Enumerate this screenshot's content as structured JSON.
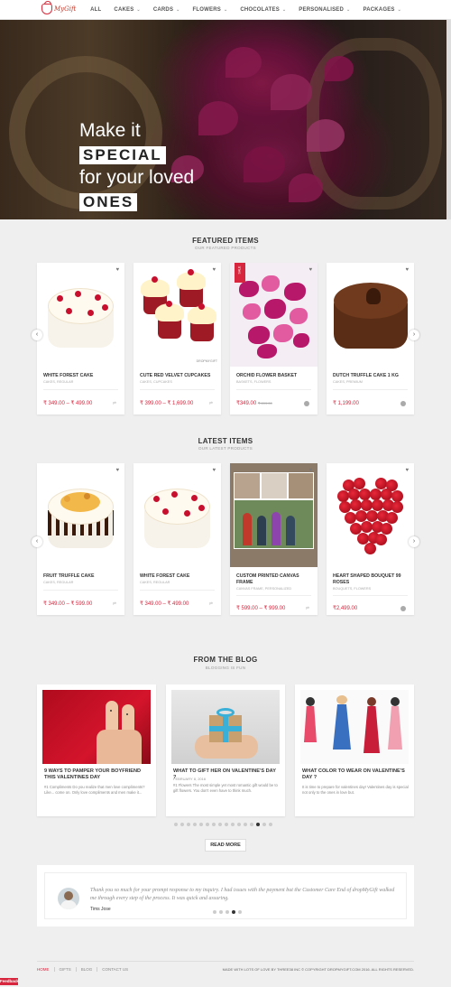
{
  "brand": {
    "logo_text": "MyGift"
  },
  "nav": {
    "items": [
      {
        "label": "ALL",
        "has_dropdown": false
      },
      {
        "label": "CAKES",
        "has_dropdown": true
      },
      {
        "label": "CARDS",
        "has_dropdown": true
      },
      {
        "label": "FLOWERS",
        "has_dropdown": true
      },
      {
        "label": "CHOCOLATES",
        "has_dropdown": true
      },
      {
        "label": "PERSONALISED",
        "has_dropdown": true
      },
      {
        "label": "PACKAGES",
        "has_dropdown": true
      }
    ],
    "chevron": "⌄"
  },
  "hero": {
    "line1": "Make it",
    "line2": "SPECIAL",
    "line3": "for your loved",
    "line4": "ONES"
  },
  "featured": {
    "title": "FEATURED ITEMS",
    "subtitle": "OUR FEATURED PRODUCTS",
    "products": [
      {
        "name": "WHITE FOREST CAKE",
        "category": "CAKES, REGULAR",
        "price": "₹ 349.00 – ₹ 499.00"
      },
      {
        "name": "CUTE RED VELVET CUPCAKES",
        "category": "CAKES, CUPCAKES",
        "price": "₹ 399.00 – ₹ 1,699.00",
        "watermark": "DROPMYGIFT"
      },
      {
        "name": "ORCHID FLOWER BASKET",
        "category": "BASKETS, FLOWERS",
        "price": "₹349.00",
        "old_price": "₹ 899.00",
        "badge": "SALE"
      },
      {
        "name": "DUTCH TRUFFLE CAKE 1 KG",
        "category": "CAKES, PREMIUM",
        "price": "₹ 1,199.00"
      }
    ]
  },
  "latest": {
    "title": "LATEST ITEMS",
    "subtitle": "OUR LATEST PRODUCTS",
    "products": [
      {
        "name": "FRUIT TRUFFLE CAKE",
        "category": "CAKES, REGULAR",
        "price": "₹ 349.00 – ₹ 599.00"
      },
      {
        "name": "WHITE FOREST CAKE",
        "category": "CAKES, REGULAR",
        "price": "₹ 349.00 – ₹ 499.00"
      },
      {
        "name": "CUSTOM PRINTED CANVAS FRAME",
        "category": "CANVAS FRAME, PERSONALIZED",
        "price": "₹ 599.00 – ₹ 999.00"
      },
      {
        "name": "HEART SHAPED BOUQUET 99 ROSES",
        "category": "BOUQUETS, FLOWERS",
        "price": "₹2,499.00"
      }
    ]
  },
  "blog": {
    "title": "FROM THE BLOG",
    "subtitle": "BLOGGING IS FUN",
    "posts": [
      {
        "title": "9 WAYS TO PAMPER YOUR BOYFRIEND THIS VALENTINES DAY",
        "date": "",
        "excerpt": "#1 Compliments Do you realize that men love compliments? Like... come on. Only love compliments and men make it..."
      },
      {
        "title": "WHAT TO GIFT HER ON VALENTINE'S DAY ?",
        "date": "FEBRUARY 8, 2016",
        "excerpt": "#1 Flowers The most simple yet most romantic gift would be to gift flowers. You don't even have to think much."
      },
      {
        "title": "WHAT COLOR TO WEAR ON VALENTINE'S DAY ?",
        "date": "",
        "excerpt": "It is time to prepare for valentines day! Valentines day is special not only to the ones in love but."
      }
    ],
    "read_more": "READ MORE"
  },
  "testimonial": {
    "quote": "Thank you so much for your prompt response to my inquiry. I had issues with the payment but the Customer Care End of dropMyGift walked me through every step of the process. It was quick and assuring.",
    "author": "Tims Jose"
  },
  "footer": {
    "links": [
      "HOME",
      "GIFTS",
      "BLOG",
      "CONTACT US"
    ],
    "copyright": "MADE WITH LOTS OF LOVE BY THREE38 INC © COPYRIGHT DROPMYGIFT.COM 2016. ALL RIGHTS RESERVED."
  },
  "feedback_label": "Feedback",
  "icons": {
    "heart": "heart-icon",
    "cart": "cart-icon",
    "arrow_left": "chevron-left-icon",
    "arrow_right": "chevron-right-icon"
  },
  "colors": {
    "accent": "#d7263d",
    "background": "#efefef"
  }
}
